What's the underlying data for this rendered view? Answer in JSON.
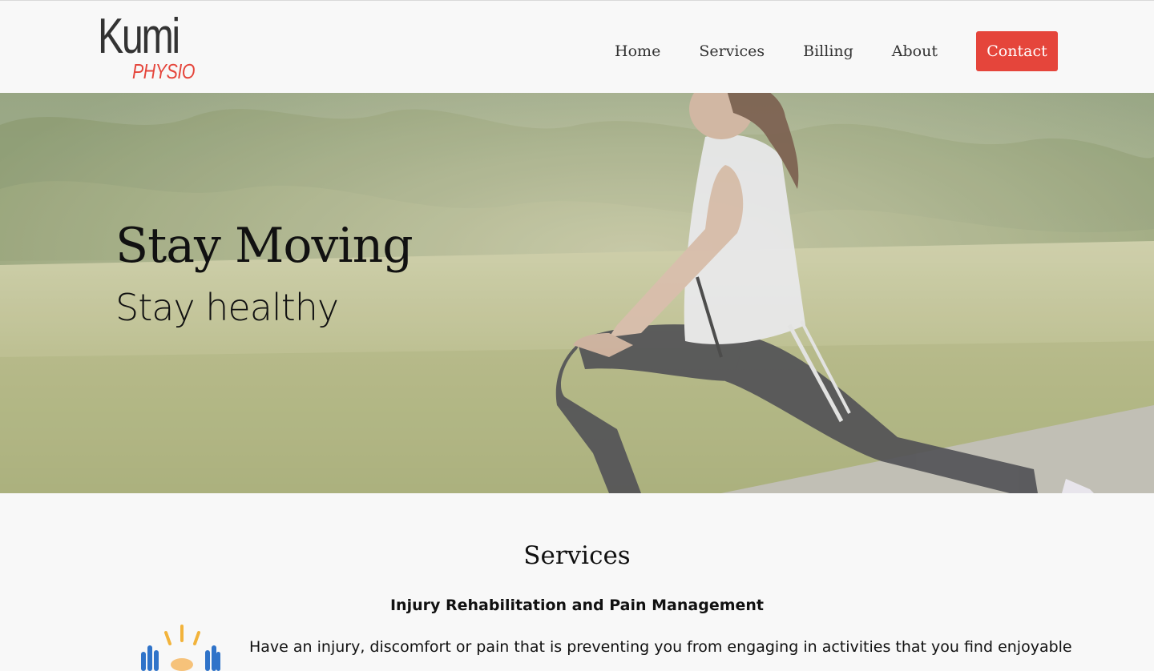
{
  "brand": {
    "logo_main": "Kumi",
    "logo_sub": "PHYSIO"
  },
  "nav": {
    "items": [
      {
        "label": "Home"
      },
      {
        "label": "Services"
      },
      {
        "label": "Billing"
      },
      {
        "label": "About"
      }
    ],
    "contact_label": "Contact"
  },
  "hero": {
    "title": "Stay Moving",
    "subtitle": "Stay healthy",
    "image_icon": "woman-stretching-photo"
  },
  "services": {
    "title": "Services",
    "items": [
      {
        "heading": "Injury Rehabilitation and Pain Management",
        "icon": "hands-pain-icon",
        "text": "Have an injury, discomfort or pain that is preventing you from engaging in activities that you find enjoyable"
      }
    ]
  },
  "colors": {
    "accent": "#e5453b",
    "text": "#333333",
    "background": "#f8f8f8"
  }
}
